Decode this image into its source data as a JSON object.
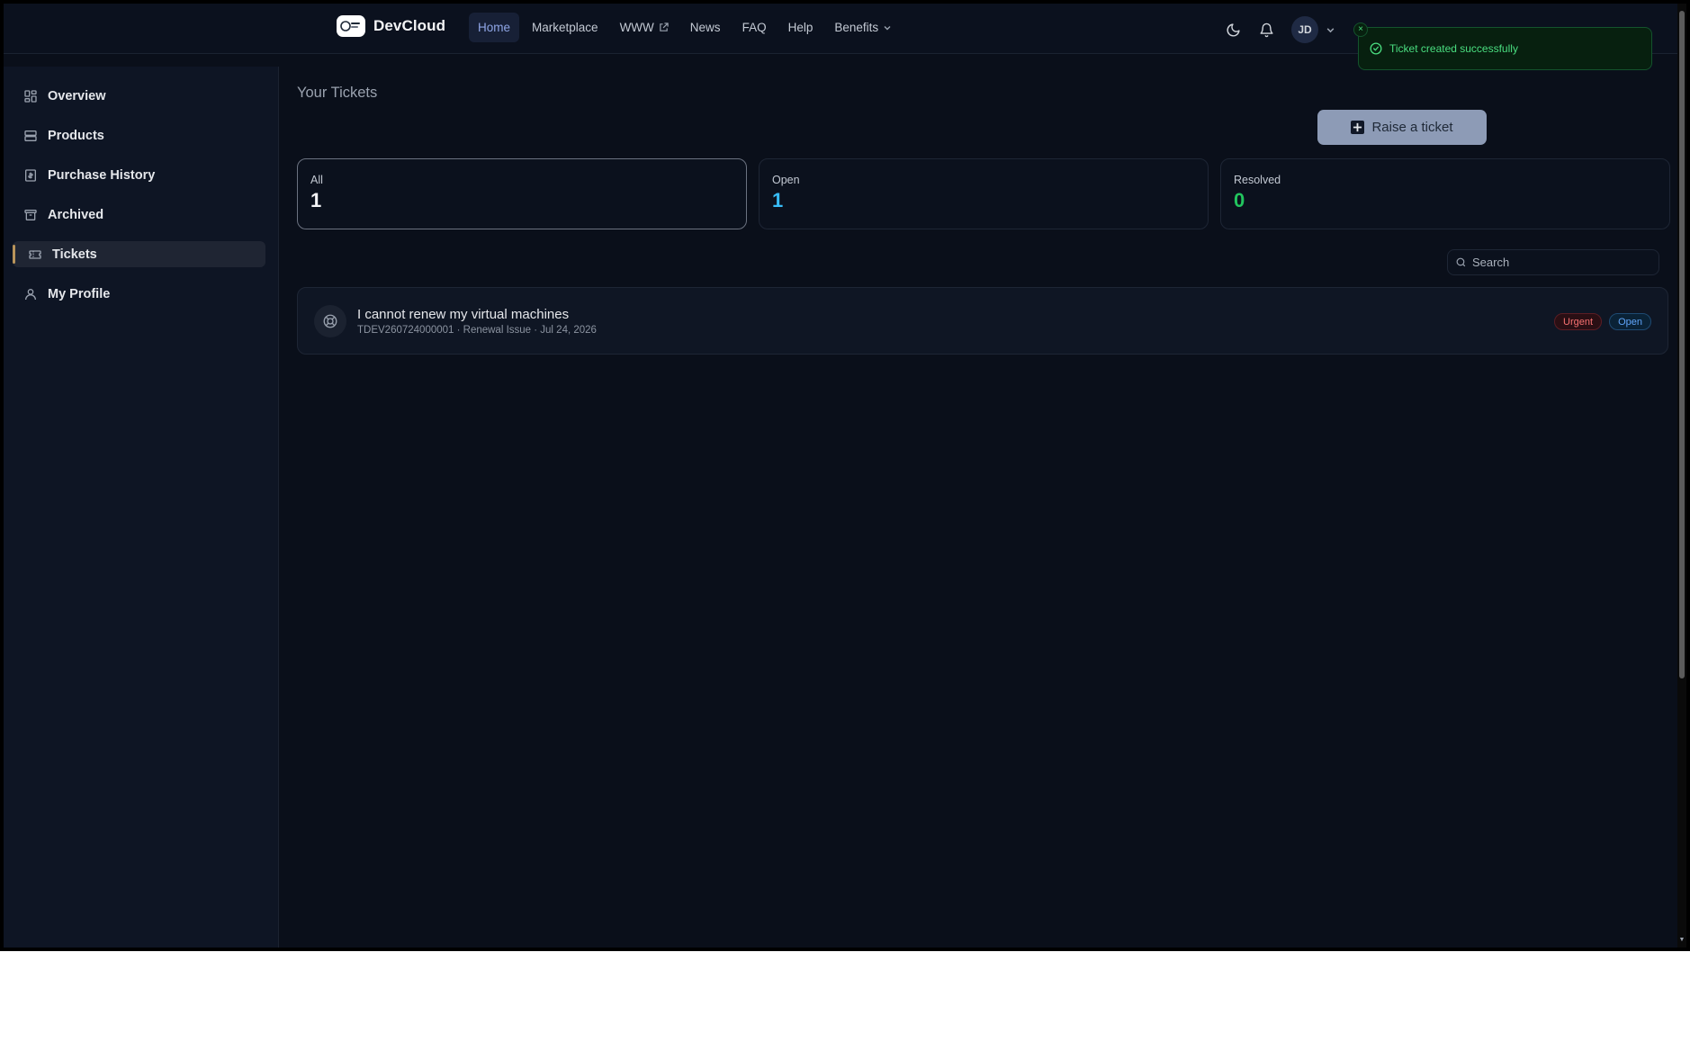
{
  "brand": {
    "name": "DevCloud"
  },
  "nav": {
    "items": [
      {
        "label": "Home"
      },
      {
        "label": "Marketplace"
      },
      {
        "label": "WWW"
      },
      {
        "label": "News"
      },
      {
        "label": "FAQ"
      },
      {
        "label": "Help"
      },
      {
        "label": "Benefits"
      }
    ]
  },
  "user": {
    "initials": "JD"
  },
  "toast": {
    "message": "Ticket created successfully",
    "close": "×"
  },
  "sidebar": {
    "items": [
      {
        "label": "Overview",
        "icon": "grid-icon"
      },
      {
        "label": "Products",
        "icon": "server-icon"
      },
      {
        "label": "Purchase History",
        "icon": "receipt-icon"
      },
      {
        "label": "Archived",
        "icon": "archive-icon"
      },
      {
        "label": "Tickets",
        "icon": "ticket-icon"
      },
      {
        "label": "My Profile",
        "icon": "user-icon"
      }
    ]
  },
  "main": {
    "title": "Your Tickets",
    "raise_button": "Raise a ticket",
    "stats": [
      {
        "label": "All",
        "value": "1",
        "color": "#f3f4f6"
      },
      {
        "label": "Open",
        "value": "1",
        "color": "#38bdf8"
      },
      {
        "label": "Resolved",
        "value": "0",
        "color": "#22c55e"
      }
    ],
    "search": {
      "placeholder": "Search"
    },
    "tickets": [
      {
        "title": "I cannot renew my virtual machines",
        "meta": "TDEV260724000001 · Renewal Issue · Jul 24, 2026",
        "priority": "Urgent",
        "status": "Open"
      }
    ]
  },
  "colors": {
    "background": "#0a0f1a",
    "accent": "#8fa6e6",
    "active_marker": "#b9945a",
    "success": "#4ade80"
  }
}
